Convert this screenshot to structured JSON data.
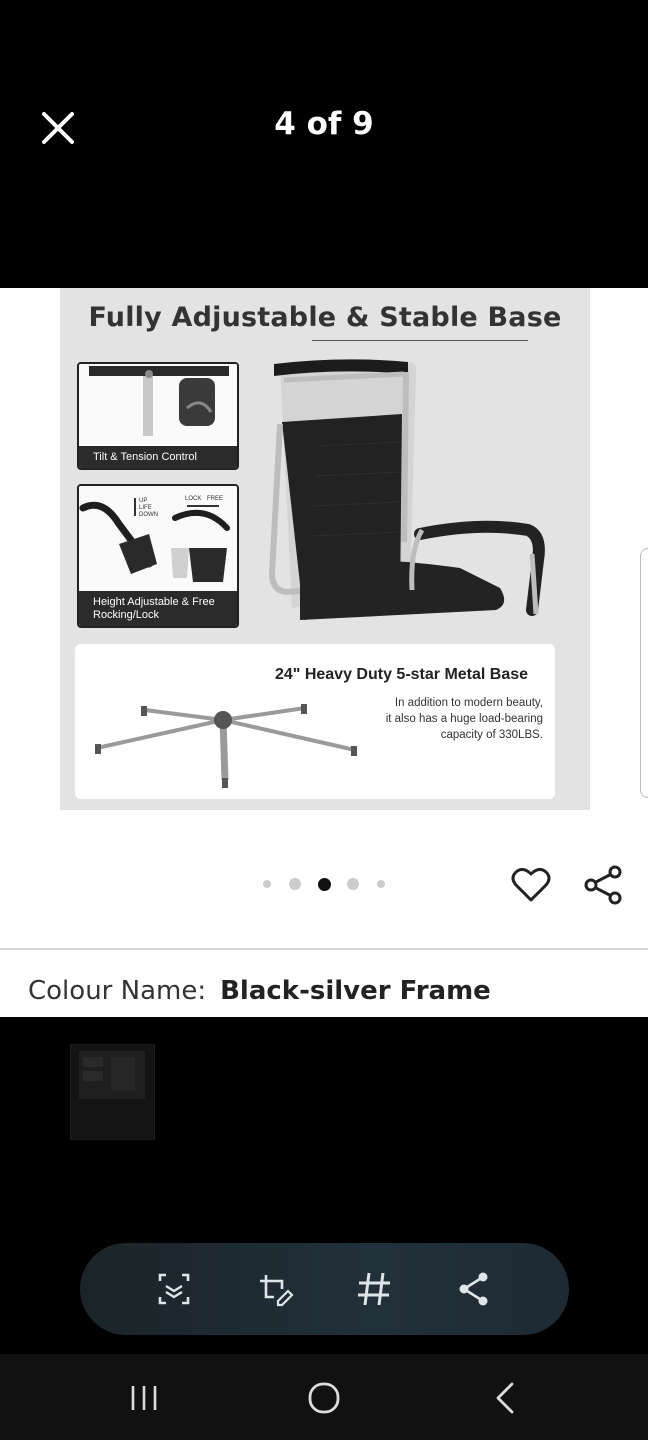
{
  "viewer": {
    "counter": "4 of 9",
    "close_icon": "close-icon"
  },
  "product_image": {
    "title": "Fully Adjustable & Stable Base",
    "callouts": [
      {
        "caption": "Tilt & Tension Control"
      },
      {
        "caption_line1": "Height Adjustable & Free",
        "caption_line2": "Rocking/Lock",
        "tag_up": "UP",
        "tag_lift": "LIFE",
        "tag_down": "DOWN",
        "tag_lock": "LOCK",
        "tag_free": "FREE"
      }
    ],
    "base": {
      "title": "24\" Heavy Duty 5-star Metal Base",
      "desc_line1": "In addition to modern beauty,",
      "desc_line2": "it also has a huge load-bearing",
      "desc_line3": "capacity of 330LBS."
    }
  },
  "carousel": {
    "total_dots_visible": 5,
    "active_dot": 3
  },
  "actions": {
    "favorite_icon": "heart-icon",
    "share_icon": "share-icon"
  },
  "colour": {
    "label": "Colour Name:",
    "value": "Black-silver Frame"
  },
  "toolbar": {
    "icons": [
      "scan-text-icon",
      "edit-crop-icon",
      "hashtag-icon",
      "share-icon"
    ]
  },
  "system_nav": {
    "icons": [
      "recents-icon",
      "home-icon",
      "back-icon"
    ]
  },
  "colors": {
    "background": "#000000",
    "panel": "#ffffff",
    "image_bg": "#e3e3e3",
    "text_dark": "#222222"
  }
}
